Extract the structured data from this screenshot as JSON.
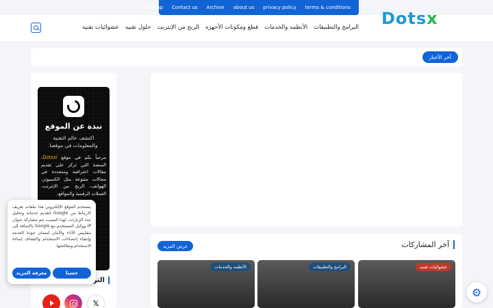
{
  "topbar": {
    "links": [
      "Sitemap",
      "Contact us",
      "Archive",
      "about us",
      "privacy policy",
      "terms & conditions"
    ]
  },
  "header": {
    "logo_part1": "Dots",
    "logo_part2": "x",
    "nav": [
      "البرامج والتطبيقات",
      "الأنظمه والخدمات",
      "قطع ومكونات الأجهزه",
      "الربح من الإنترنت",
      "حلول تقنيه",
      "عشوائيات تقنيه"
    ]
  },
  "ticker": {
    "label": "آخر الأخبار"
  },
  "about": {
    "title": "نبذة عن الموقع",
    "subtitle": "اكتشف عالم التقنية والمعلومات في موقعنا",
    "body_prefix": "مرحباً بكم في موقع ",
    "body_brand": "Dotsxi",
    "body_rest": "، المنصة التي تركز على تقديم مقالات احترافية ومتجددة في مجالات متنوعة مثل الكمبيوتر، الهواتف، الربح من الإنترنت، العملات الرقمية والمواقع."
  },
  "social": {
    "title": "التواصل"
  },
  "posts": {
    "title": "آخر المشاركات",
    "more_label": "عرض المزيد",
    "cards": [
      {
        "tag": "عشوائيات تقنيه"
      },
      {
        "tag": "البرامج والتطبيقات"
      },
      {
        "tag": "الأنظمه والخدمات"
      }
    ]
  },
  "cookie": {
    "text": "يستخدم الموقع الإلكتروني هذا ملفات تعريف الارتباط من Google لتقديم خدماته وتحليل عدد الزيارات. لهذا السبب، تتم مشاركة عنوان IP ووكيل المستخدم مع Google بالإضافة إلى مقاييس الأداء والأمان لضمان جودة الخدمة وإنشاء إحصاءات الاستخدام واكتشاف إساءة الاستخدام ومعالجتها.",
    "accept_label": "حسنا",
    "more_label": "معرفة المزيد"
  },
  "icons": {
    "search": "search-icon",
    "settings": "gear-icon",
    "x": "x-logo-icon",
    "instagram": "instagram-icon",
    "youtube": "youtube-icon"
  },
  "colors": {
    "accent": "#1164d6",
    "logo_blue": "#1a9ad6",
    "logo_green": "#2cb54a",
    "tag_red": "#c0392b"
  }
}
